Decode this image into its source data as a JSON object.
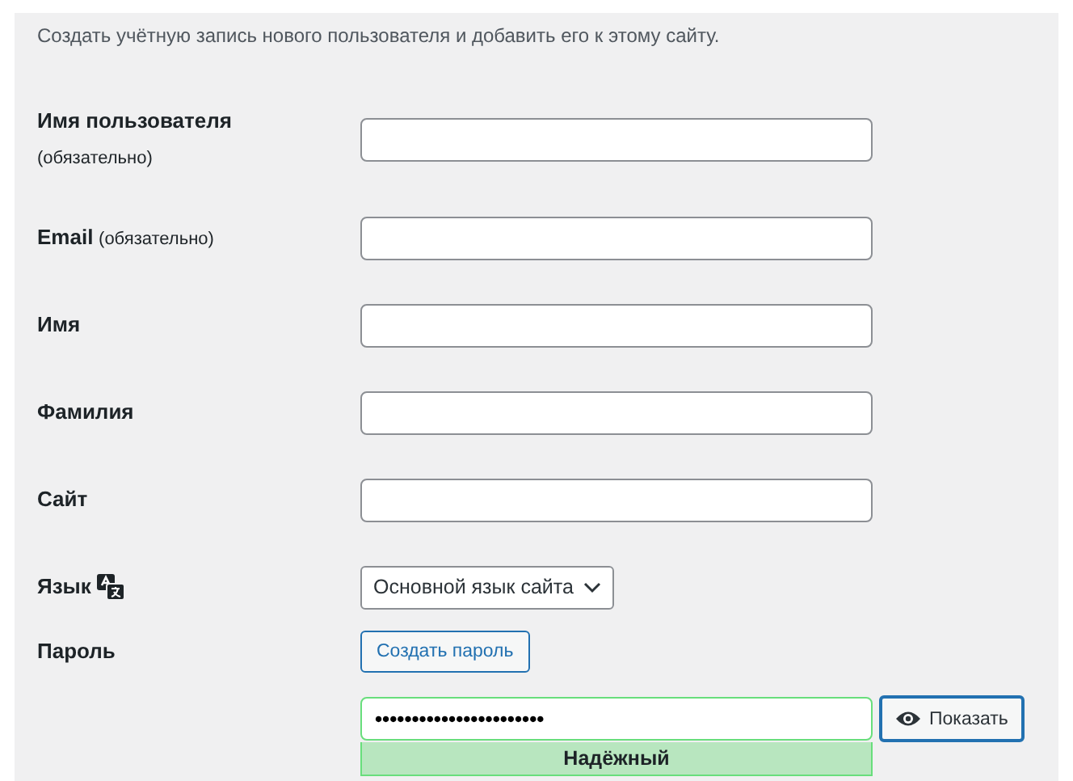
{
  "intro": "Создать учётную запись нового пользователя и добавить его к этому сайту.",
  "fields": [
    {
      "label": "Имя пользователя",
      "note": "(обязательно)"
    },
    {
      "label": "Email",
      "note": "(обязательно)"
    },
    {
      "label": "Имя"
    },
    {
      "label": "Фамилия"
    },
    {
      "label": "Сайт"
    }
  ],
  "language": {
    "label": "Язык",
    "value": "Основной язык сайта"
  },
  "password": {
    "label": "Пароль",
    "generate_button": "Создать пароль",
    "value": "•••••••••••••••••••••••",
    "show_button": "Показать",
    "strength": "Надёжный"
  }
}
